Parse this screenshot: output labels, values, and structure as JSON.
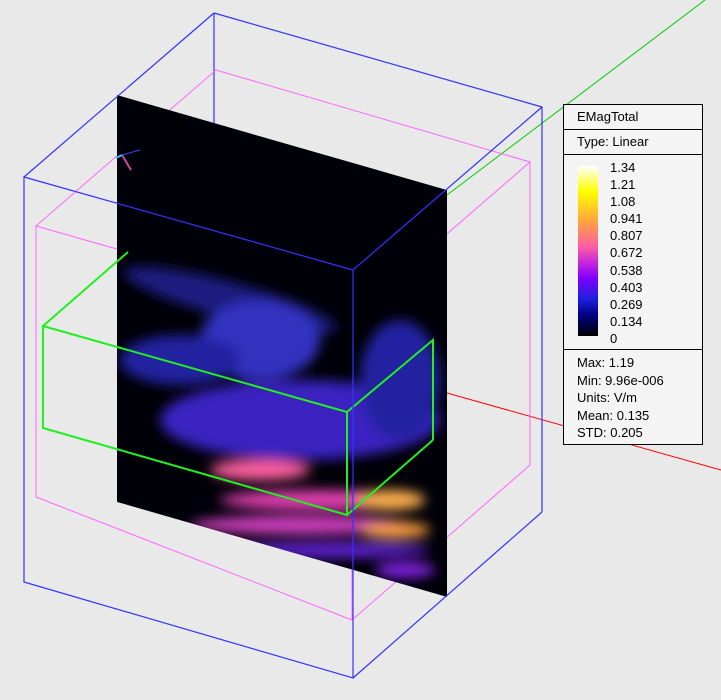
{
  "legend": {
    "title": "EMagTotal",
    "type": "Type: Linear",
    "ticks": [
      "1.34",
      "1.21",
      "1.08",
      "0.941",
      "0.807",
      "0.672",
      "0.538",
      "0.403",
      "0.269",
      "0.134",
      "0"
    ],
    "stats": {
      "max": "Max: 1.19",
      "min": "Min: 9.96e-006",
      "units": "Units: V/m",
      "mean": "Mean: 0.135",
      "std": "STD: 0.205"
    }
  },
  "colors": {
    "outer_box": "#3333ff",
    "inner_box": "#ff66ff",
    "port_box": "#22ee22",
    "x_axis": "#ff0000",
    "y_axis": "#00cc00"
  }
}
